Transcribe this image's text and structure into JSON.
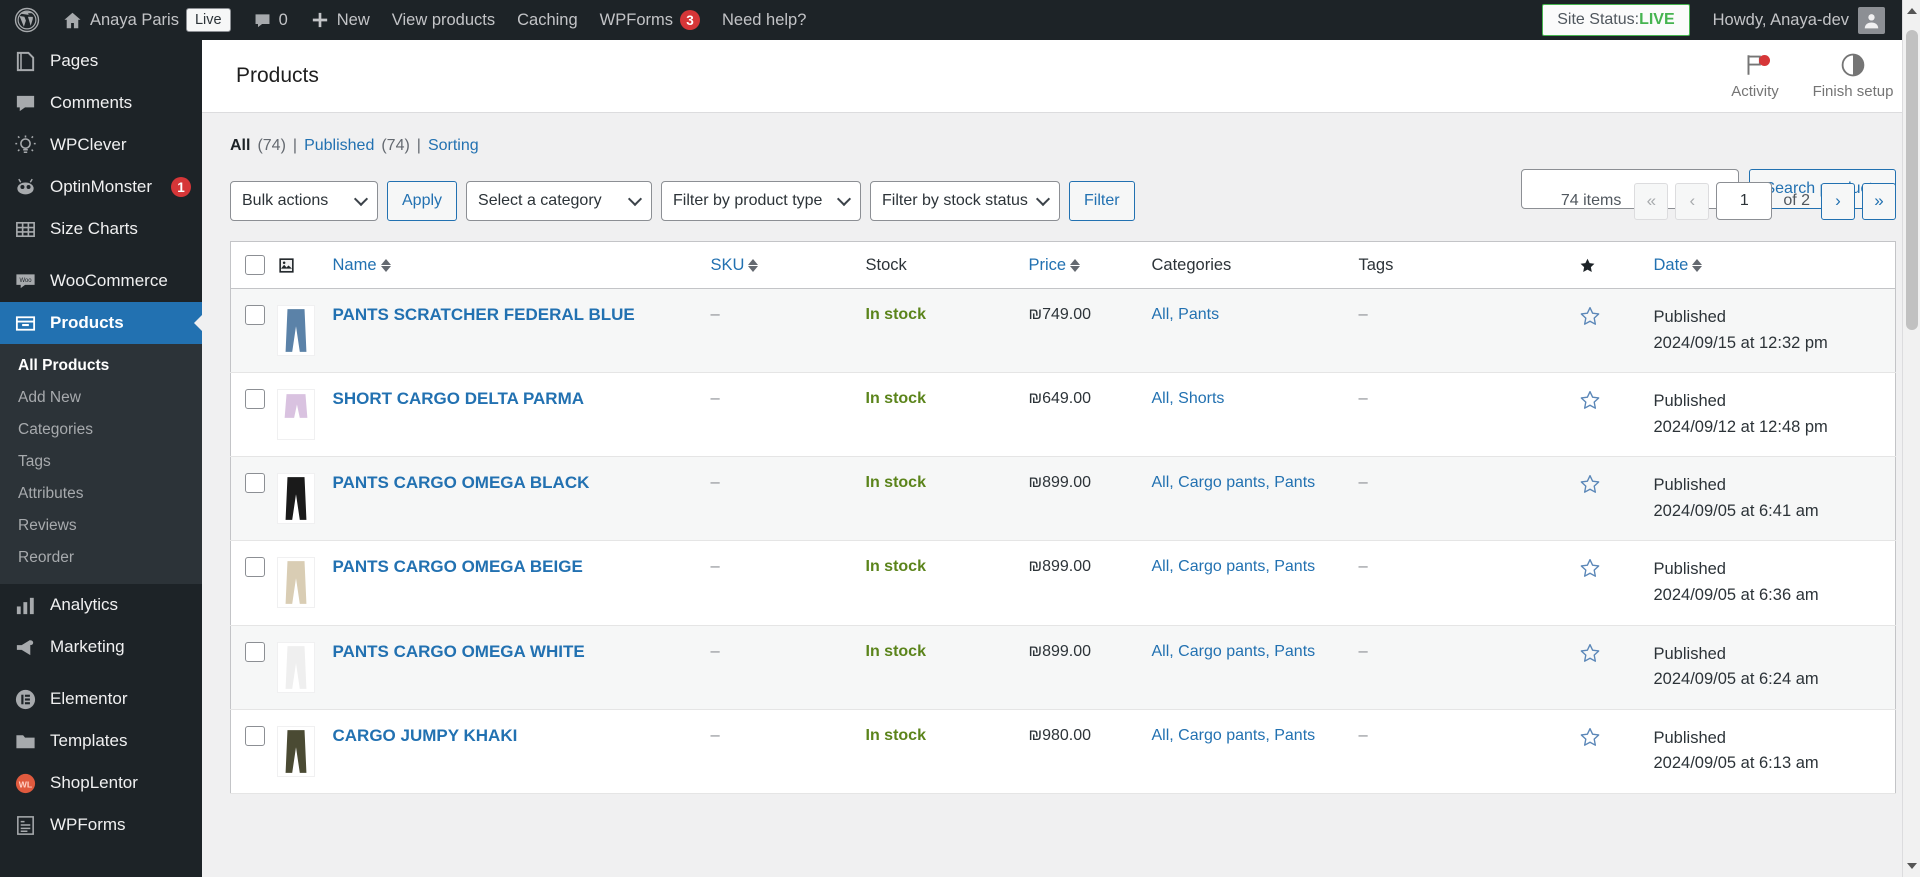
{
  "adminbar": {
    "logo_icon": "wordpress-logo-icon",
    "home_icon": "home-icon",
    "site_name": "Anaya Paris",
    "live_badge": "Live",
    "comments_icon": "comment-bubble-icon",
    "comments_count": "0",
    "new_icon": "plus-icon",
    "new_label": "New",
    "view_products_label": "View products",
    "caching_label": "Caching",
    "wpforms_label": "WPForms",
    "wpforms_count": "3",
    "need_help_label": "Need help?",
    "site_status_prefix": "Site Status:",
    "site_status_value": "LIVE",
    "howdy_label": "Howdy, Anaya-dev",
    "avatar_icon": "user-avatar-icon"
  },
  "sidebar": {
    "items": [
      {
        "label": "Pages",
        "icon": "pages-icon",
        "current": false
      },
      {
        "label": "Comments",
        "icon": "comments-icon",
        "current": false
      },
      {
        "label": "WPClever",
        "icon": "wpclever-icon",
        "current": false
      },
      {
        "label": "OptinMonster",
        "icon": "optinmonster-icon",
        "current": false,
        "badge": "1"
      },
      {
        "label": "Size Charts",
        "icon": "size-charts-icon",
        "current": false
      },
      {
        "label": "WooCommerce",
        "icon": "woocommerce-icon",
        "current": false
      },
      {
        "label": "Products",
        "icon": "products-icon",
        "current": true
      },
      {
        "label": "Analytics",
        "icon": "analytics-icon",
        "current": false
      },
      {
        "label": "Marketing",
        "icon": "marketing-icon",
        "current": false
      },
      {
        "label": "Elementor",
        "icon": "elementor-icon",
        "current": false
      },
      {
        "label": "Templates",
        "icon": "templates-icon",
        "current": false
      },
      {
        "label": "ShopLentor",
        "icon": "shoplentor-icon",
        "current": false
      },
      {
        "label": "WPForms",
        "icon": "wpforms-icon",
        "current": false
      }
    ],
    "submenu": [
      {
        "label": "All Products",
        "current": true
      },
      {
        "label": "Add New",
        "current": false
      },
      {
        "label": "Categories",
        "current": false
      },
      {
        "label": "Tags",
        "current": false
      },
      {
        "label": "Attributes",
        "current": false
      },
      {
        "label": "Reviews",
        "current": false
      },
      {
        "label": "Reorder",
        "current": false
      }
    ]
  },
  "woo_header": {
    "title": "Products",
    "activity_label": "Activity",
    "activity_icon": "flag-icon",
    "finish_setup_label": "Finish setup",
    "finish_setup_icon": "half-circle-icon"
  },
  "views": {
    "all_label": "All",
    "all_count": "(74)",
    "published_label": "Published",
    "published_count": "(74)",
    "sorting_label": "Sorting",
    "separator": "|"
  },
  "search": {
    "value": "",
    "placeholder": "",
    "button_label": "Search products"
  },
  "tablenav": {
    "bulk_actions": "Bulk actions",
    "apply_label": "Apply",
    "select_category": "Select a category",
    "filter_product_type": "Filter by product type",
    "filter_stock_status": "Filter by stock status",
    "filter_label": "Filter",
    "items_count": "74 items",
    "first_page_icon": "«",
    "prev_page_icon": "‹",
    "current_page": "1",
    "of_label": "of 2",
    "next_page_icon": "›",
    "last_page_icon": "»"
  },
  "table": {
    "columns": {
      "checkbox": "select-all",
      "thumb": "image-icon",
      "name": "Name",
      "sku": "SKU",
      "stock": "Stock",
      "price": "Price",
      "categories": "Categories",
      "tags": "Tags",
      "featured": "star-icon",
      "date": "Date"
    },
    "rows": [
      {
        "name": "PANTS SCRATCHER FEDERAL BLUE",
        "sku": "–",
        "stock": "In stock",
        "price": "₪749.00",
        "categories": "All, Pants",
        "tags": "–",
        "featured": "star-outline-icon",
        "status": "Published",
        "date": "2024/09/15 at 12:32 pm",
        "thumb_color": "#5b82a8",
        "thumb_type": "pants"
      },
      {
        "name": "SHORT CARGO DELTA PARMA",
        "sku": "–",
        "stock": "In stock",
        "price": "₪649.00",
        "categories": "All, Shorts",
        "tags": "–",
        "featured": "star-outline-icon",
        "status": "Published",
        "date": "2024/09/12 at 12:48 pm",
        "thumb_color": "#d9c2e0",
        "thumb_type": "shorts"
      },
      {
        "name": "PANTS CARGO OMEGA BLACK",
        "sku": "–",
        "stock": "In stock",
        "price": "₪899.00",
        "categories": "All, Cargo pants, Pants",
        "tags": "–",
        "featured": "star-outline-icon",
        "status": "Published",
        "date": "2024/09/05 at 6:41 am",
        "thumb_color": "#1a1a1a",
        "thumb_type": "pants"
      },
      {
        "name": "PANTS CARGO OMEGA BEIGE",
        "sku": "–",
        "stock": "In stock",
        "price": "₪899.00",
        "categories": "All, Cargo pants, Pants",
        "tags": "–",
        "featured": "star-outline-icon",
        "status": "Published",
        "date": "2024/09/05 at 6:36 am",
        "thumb_color": "#d9cdb4",
        "thumb_type": "pants"
      },
      {
        "name": "PANTS CARGO OMEGA WHITE",
        "sku": "–",
        "stock": "In stock",
        "price": "₪899.00",
        "categories": "All, Cargo pants, Pants",
        "tags": "–",
        "featured": "star-outline-icon",
        "status": "Published",
        "date": "2024/09/05 at 6:24 am",
        "thumb_color": "#efefef",
        "thumb_type": "pants"
      },
      {
        "name": "CARGO JUMPY KHAKI",
        "sku": "–",
        "stock": "In stock",
        "price": "₪980.00",
        "categories": "All, Cargo pants, Pants",
        "tags": "–",
        "featured": "star-outline-icon",
        "status": "Published",
        "date": "2024/09/05 at 6:13 am",
        "thumb_color": "#4a4a33",
        "thumb_type": "pants"
      }
    ]
  },
  "colors": {
    "admin_bar_bg": "#1d2327",
    "sidebar_bg": "#1d2327",
    "submenu_bg": "#2c3338",
    "accent_blue": "#2271b1",
    "current_menu_bg": "#2271b1",
    "in_stock_green": "#5b841b",
    "badge_red": "#d63638",
    "live_green": "#46b450",
    "content_bg": "#f0f0f1"
  }
}
